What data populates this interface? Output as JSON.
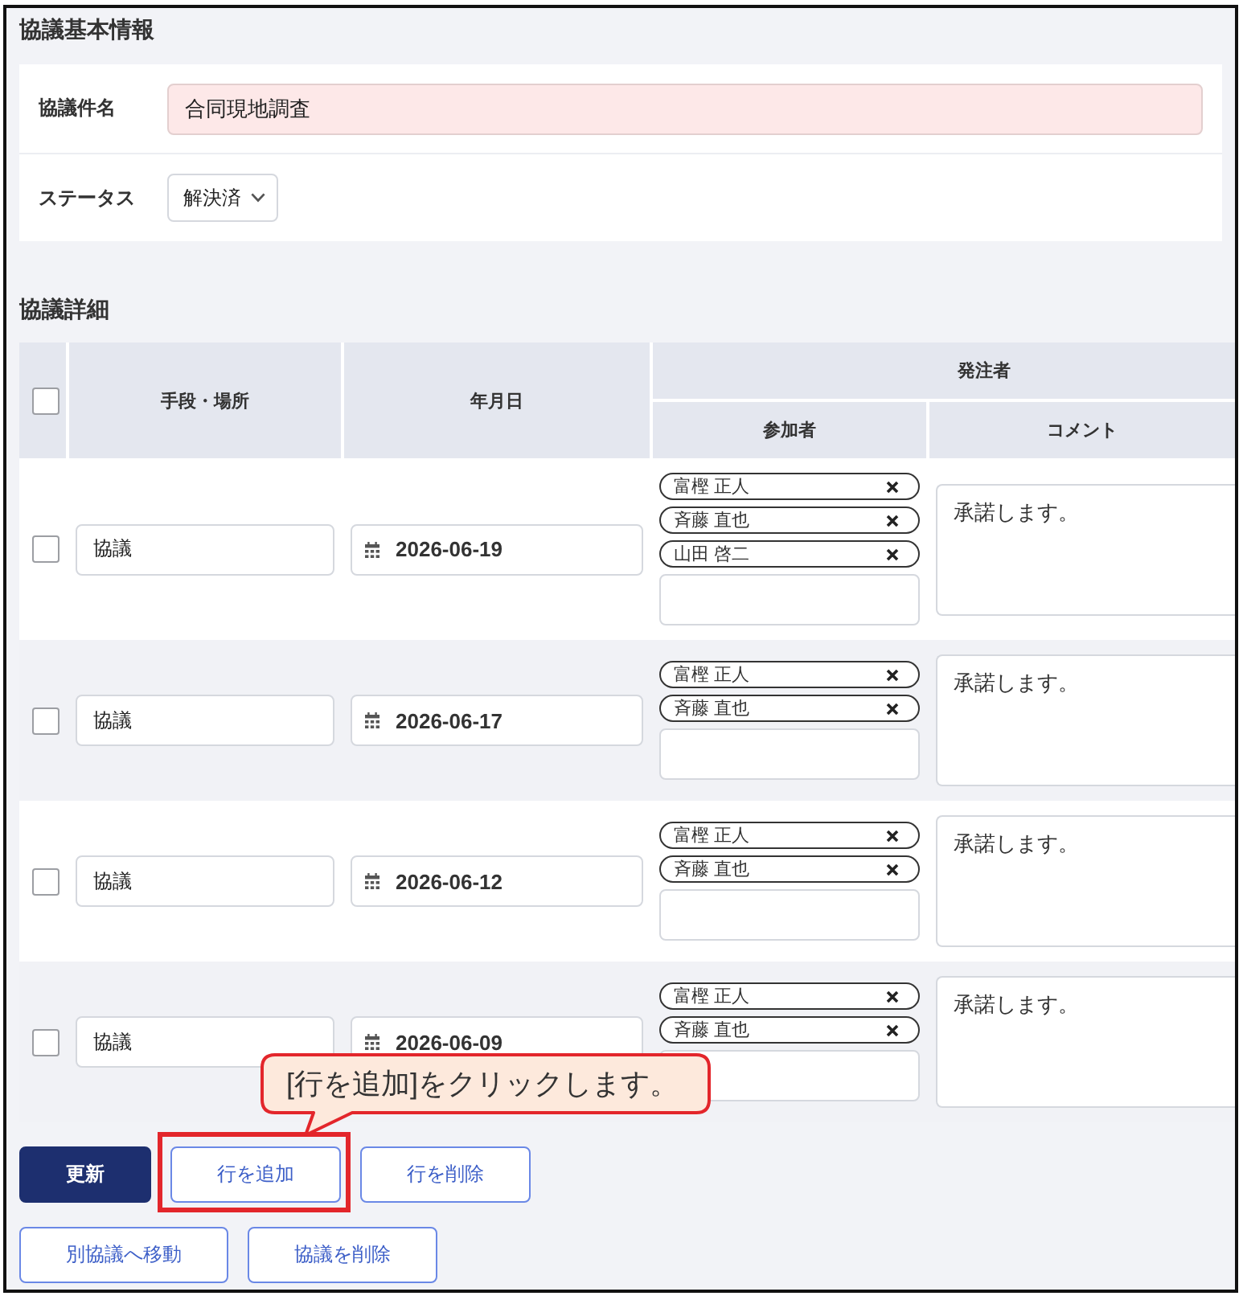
{
  "basic_info": {
    "title": "協議基本情報",
    "fields": [
      {
        "kind": "text",
        "label": "協議件名",
        "value": "合同現地調査",
        "required": true
      },
      {
        "kind": "select",
        "label": "ステータス",
        "value": "解決済"
      }
    ]
  },
  "details": {
    "title": "協議詳細",
    "table": {
      "select_all": {
        "checked": false
      },
      "columns": [
        {
          "label": "手段・場所"
        },
        {
          "label": "年月日"
        },
        {
          "label": "発注者",
          "children": [
            {
              "label": "参加者"
            },
            {
              "label": "コメント"
            }
          ]
        }
      ],
      "rows": [
        {
          "checked": false,
          "method": "協議",
          "date": "2026-06-19",
          "participants": [
            "富樫 正人",
            "斉藤 直也",
            "山田 啓二"
          ],
          "comment": "承諾します。"
        },
        {
          "checked": false,
          "method": "協議",
          "date": "2026-06-17",
          "participants": [
            "富樫 正人",
            "斉藤 直也"
          ],
          "comment": "承諾します。"
        },
        {
          "checked": false,
          "method": "協議",
          "date": "2026-06-12",
          "participants": [
            "富樫 正人",
            "斉藤 直也"
          ],
          "comment": "承諾します。"
        },
        {
          "checked": false,
          "method": "協議",
          "date": "2026-06-09",
          "participants": [
            "富樫 正人",
            "斉藤 直也"
          ],
          "comment": "承諾します。"
        }
      ]
    }
  },
  "button_rows": [
    [
      {
        "label": "更新",
        "kind": "primary",
        "highlighted": false
      },
      {
        "label": "行を追加",
        "kind": "secondary",
        "highlighted": true
      },
      {
        "label": "行を削除",
        "kind": "secondary",
        "highlighted": false
      }
    ],
    [
      {
        "label": "別協議へ移動",
        "kind": "secondary",
        "highlighted": false
      },
      {
        "label": "協議を削除",
        "kind": "secondary",
        "highlighted": false
      }
    ]
  ],
  "callout": {
    "text": "[行を追加]をクリックします。"
  }
}
